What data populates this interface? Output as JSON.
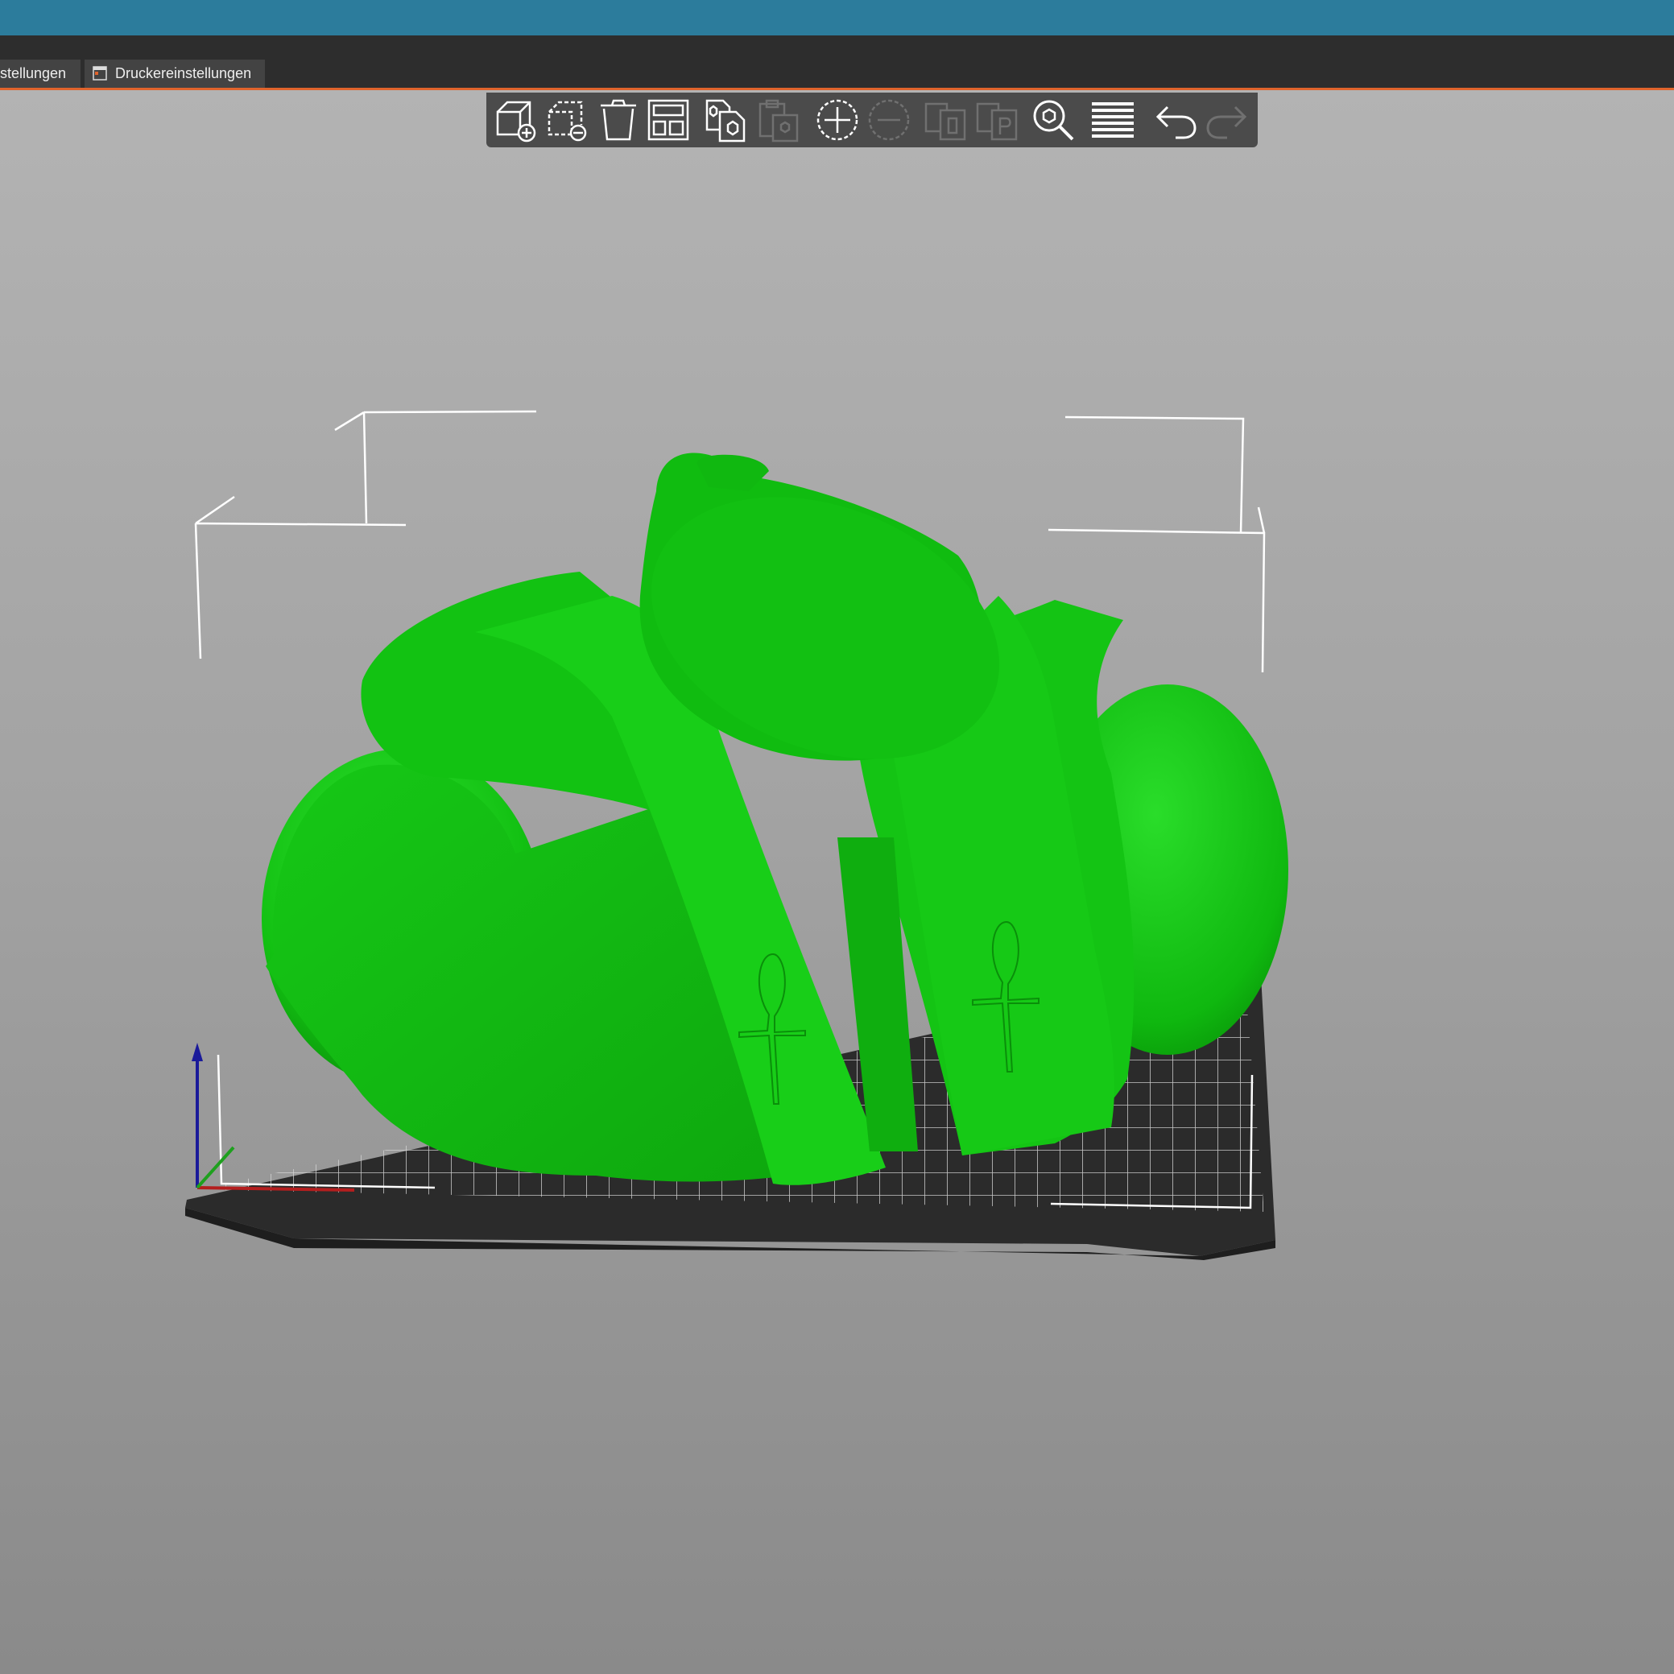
{
  "window": {
    "titlebar_color": "#2c7c9c"
  },
  "tabs": [
    {
      "label": "stellungen"
    },
    {
      "label": "Druckereinstellungen",
      "icon": "printer-settings-icon"
    }
  ],
  "toolbar": {
    "buttons": [
      {
        "name": "add-object",
        "icon": "add-cube-icon",
        "enabled": true
      },
      {
        "name": "delete-object",
        "icon": "remove-cube-icon",
        "enabled": true
      },
      {
        "name": "delete-all",
        "icon": "trash-icon",
        "enabled": true
      },
      {
        "name": "arrange",
        "icon": "arrange-icon",
        "enabled": true
      },
      {
        "name": "copy",
        "icon": "copy-icon",
        "enabled": true
      },
      {
        "name": "paste",
        "icon": "paste-icon",
        "enabled": false
      },
      {
        "name": "add-instance",
        "icon": "plus-circle-icon",
        "enabled": true
      },
      {
        "name": "remove-instance",
        "icon": "minus-circle-icon",
        "enabled": false
      },
      {
        "name": "split-objects",
        "icon": "split-objects-icon",
        "enabled": false
      },
      {
        "name": "split-parts",
        "icon": "split-parts-icon",
        "enabled": false
      },
      {
        "name": "search",
        "icon": "search-icon",
        "enabled": true
      },
      {
        "name": "layers",
        "icon": "layers-icon",
        "enabled": true
      },
      {
        "name": "undo",
        "icon": "undo-icon",
        "enabled": true
      },
      {
        "name": "redo",
        "icon": "redo-icon",
        "enabled": false
      }
    ]
  },
  "viewport": {
    "model_color": "#1ec81e",
    "bed_color": "#2a2a2a",
    "axes": [
      "x-axis",
      "y-axis",
      "z-axis"
    ]
  }
}
